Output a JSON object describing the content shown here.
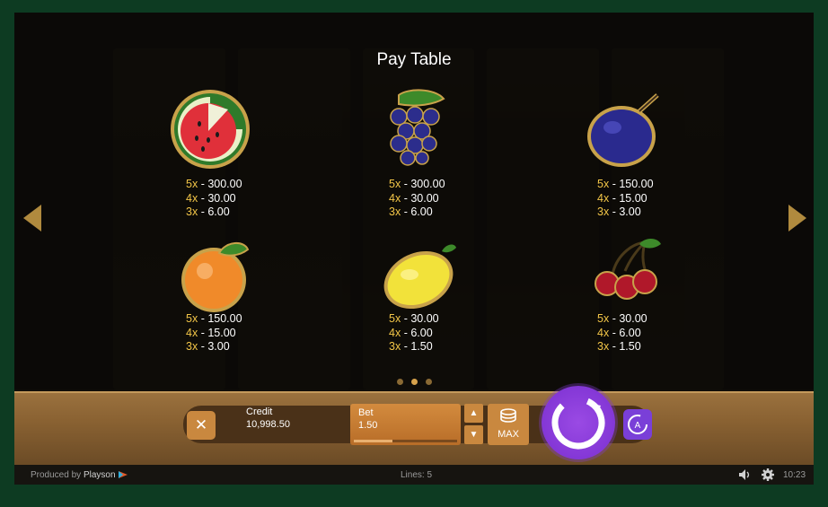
{
  "paytable": {
    "title": "Pay Table",
    "symbols": [
      {
        "name": "watermelon",
        "icon": "watermelon-icon",
        "pays": [
          {
            "mult": "5x",
            "value": "- 300.00"
          },
          {
            "mult": "4x",
            "value": "- 30.00"
          },
          {
            "mult": "3x",
            "value": "- 6.00"
          }
        ]
      },
      {
        "name": "grapes",
        "icon": "grapes-icon",
        "pays": [
          {
            "mult": "5x",
            "value": "- 300.00"
          },
          {
            "mult": "4x",
            "value": "- 30.00"
          },
          {
            "mult": "3x",
            "value": "- 6.00"
          }
        ]
      },
      {
        "name": "plum",
        "icon": "plum-icon",
        "pays": [
          {
            "mult": "5x",
            "value": "- 150.00"
          },
          {
            "mult": "4x",
            "value": "- 15.00"
          },
          {
            "mult": "3x",
            "value": "- 3.00"
          }
        ]
      },
      {
        "name": "orange",
        "icon": "orange-icon",
        "pays": [
          {
            "mult": "5x",
            "value": "- 150.00"
          },
          {
            "mult": "4x",
            "value": "- 15.00"
          },
          {
            "mult": "3x",
            "value": "- 3.00"
          }
        ]
      },
      {
        "name": "lemon",
        "icon": "lemon-icon",
        "pays": [
          {
            "mult": "5x",
            "value": "- 30.00"
          },
          {
            "mult": "4x",
            "value": "- 6.00"
          },
          {
            "mult": "3x",
            "value": "- 1.50"
          }
        ]
      },
      {
        "name": "cherries",
        "icon": "cherries-icon",
        "pays": [
          {
            "mult": "5x",
            "value": "- 30.00"
          },
          {
            "mult": "4x",
            "value": "- 6.00"
          },
          {
            "mult": "3x",
            "value": "- 1.50"
          }
        ]
      }
    ],
    "page_dots": {
      "count": 3,
      "active": 2
    }
  },
  "controls": {
    "close_label": "✕",
    "credit_label": "Credit",
    "credit_value": "10,998.50",
    "bet_label": "Bet",
    "bet_value": "1.50",
    "bet_level": 0.37,
    "step_up": "▲",
    "step_down": "▼",
    "max_label": "MAX",
    "spin_icon": "spin-icon",
    "autoplay_icon": "autoplay-icon"
  },
  "footer": {
    "produced_by": "Produced by",
    "brand": "Playson",
    "lines": "Lines: 5",
    "time": "10:23"
  },
  "colors": {
    "multiplier": "#f3c648",
    "spin": "#8a3be0",
    "button": "#c9883f",
    "frame": "#0d3b22"
  }
}
